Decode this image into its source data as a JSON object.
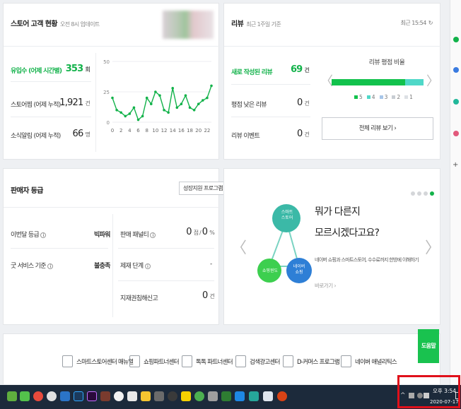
{
  "customer_card": {
    "title": "스토어 고객 현황",
    "updated": "오전 8시 업데이트",
    "stats": [
      {
        "label": "유입수 (어제 시간별)",
        "value": "353",
        "unit": "회",
        "highlight": true
      },
      {
        "label": "스토어찜 (어제 누적)",
        "value": "1,921",
        "unit": "건",
        "highlight": false
      },
      {
        "label": "소식알림 (어제 누적)",
        "value": "66",
        "unit": "명",
        "highlight": false
      }
    ],
    "chart_data": {
      "type": "line",
      "x": [
        0,
        1,
        2,
        3,
        4,
        5,
        6,
        7,
        8,
        9,
        10,
        11,
        12,
        13,
        14,
        15,
        16,
        17,
        18,
        19,
        20,
        21,
        22,
        23
      ],
      "values": [
        20,
        10,
        8,
        5,
        7,
        12,
        2,
        5,
        20,
        15,
        25,
        22,
        10,
        8,
        28,
        12,
        15,
        22,
        12,
        10,
        15,
        18,
        20,
        30
      ],
      "xticks": [
        "0",
        "2",
        "4",
        "6",
        "8",
        "10",
        "12",
        "14",
        "16",
        "18",
        "20",
        "22"
      ],
      "yticks": [
        "50",
        "25",
        "0"
      ],
      "ylim": [
        0,
        50
      ],
      "color": "#12b24a"
    }
  },
  "review_card": {
    "title": "리뷰",
    "sub": "최근 1주일 기준",
    "updated": "최근 15:54",
    "stats": [
      {
        "label": "새로 작성된 리뷰",
        "value": "69",
        "unit": "건",
        "highlight": true
      },
      {
        "label": "평점 낮은 리뷰",
        "value": "0",
        "unit": "건",
        "highlight": false
      },
      {
        "label": "리뷰 이벤트",
        "value": "0",
        "unit": "건",
        "highlight": false
      }
    ],
    "ratio_title": "리뷰 평점 비율",
    "ratio": [
      {
        "label": "5",
        "value": 0.8,
        "color": "#12c24c"
      },
      {
        "label": "4",
        "value": 0.2,
        "color": "#4fd8c8"
      },
      {
        "label": "3",
        "value": 0,
        "color": "#a7c6e8"
      },
      {
        "label": "2",
        "value": 0,
        "color": "#c8cdd3"
      },
      {
        "label": "1",
        "value": 0,
        "color": "#dde0e4"
      }
    ],
    "button": "전체 리뷰 보기 ›"
  },
  "seller_card": {
    "title": "판매자 등급",
    "program_button": "성장지원 프로그램 ›",
    "left": [
      {
        "label": "이번달 등급",
        "value": "빅파워"
      },
      {
        "label": "굿 서비스 기준",
        "value": "불충족"
      }
    ],
    "right": [
      {
        "label": "판매 패널티",
        "value": "0",
        "unit": "점 / ",
        "value2": "0",
        "unit2": "%"
      },
      {
        "label": "제재 단계",
        "value": "-"
      },
      {
        "label": "지재권침해신고",
        "value": "0",
        "unit": "건"
      }
    ]
  },
  "promo_card": {
    "headline_1": "뭐가 다른지",
    "headline_2": "모르시겠다고요?",
    "description": "네이버 쇼핑과 스마트스토어, 수수료까지 한방에 이해하기",
    "link": "바로가기 ›",
    "circles": [
      "스마트\n스토어",
      "쇼핑윈도",
      "네이버\n쇼핑"
    ]
  },
  "footer_links": [
    "스마트스토어센터 매뉴얼",
    "쇼핑파트너센터",
    "톡톡 파트너센터",
    "검색광고센터",
    "D-커머스 프로그램",
    "네이버 애널리틱스"
  ],
  "help_button": "도움말",
  "taskbar": {
    "time": "오후 3:54",
    "date": "2020-07-17"
  }
}
